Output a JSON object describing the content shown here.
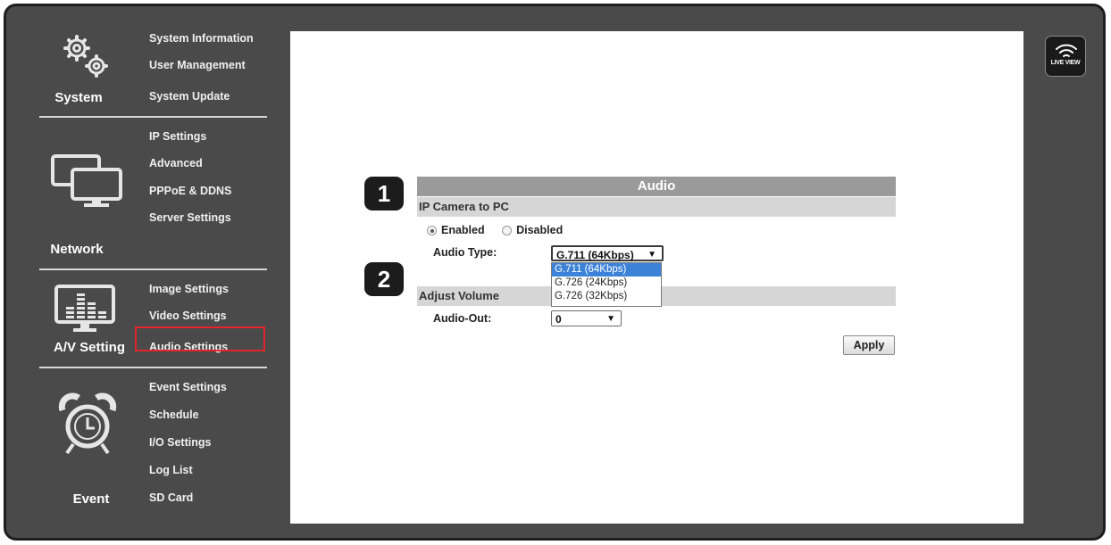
{
  "sidebar": {
    "system": {
      "label": "System",
      "icon": "gears-icon",
      "items": [
        "System Information",
        "User Management",
        "System Update"
      ]
    },
    "network": {
      "label": "Network",
      "icon": "monitors-icon",
      "items": [
        "IP Settings",
        "Advanced",
        "PPPoE & DDNS",
        "Server Settings"
      ]
    },
    "av": {
      "label": "A/V Setting",
      "icon": "equalizer-monitor-icon",
      "items": [
        "Image Settings",
        "Video Settings",
        "Audio Settings"
      ],
      "active_item": "Audio Settings"
    },
    "event": {
      "label": "Event",
      "icon": "alarm-clock-icon",
      "items": [
        "Event Settings",
        "Schedule",
        "I/O Settings",
        "Log List",
        "SD Card"
      ]
    }
  },
  "audio": {
    "title": "Audio",
    "section1": "IP Camera to PC",
    "enabled_label": "Enabled",
    "disabled_label": "Disabled",
    "selected_mode": "Enabled",
    "audio_type_label": "Audio Type:",
    "audio_type_value": "G.711 (64Kbps)",
    "audio_type_options": [
      "G.711 (64Kbps)",
      "G.726 (24Kbps)",
      "G.726 (32Kbps)"
    ],
    "section2": "Adjust Volume",
    "audio_out_label": "Audio-Out:",
    "audio_out_value": "0",
    "apply_label": "Apply"
  },
  "annotations": {
    "step1": "1",
    "step2": "2"
  },
  "live_view": {
    "label": "LIVE VIEW",
    "icon": "wifi-signal-icon"
  },
  "colors": {
    "frame": "#4a4a4a",
    "highlight": "#e2252a",
    "header_bar": "#9a9a9a",
    "section_bar": "#d6d6d6",
    "selected_option": "#3c83d8"
  },
  "dropdown_arrow": "▼"
}
